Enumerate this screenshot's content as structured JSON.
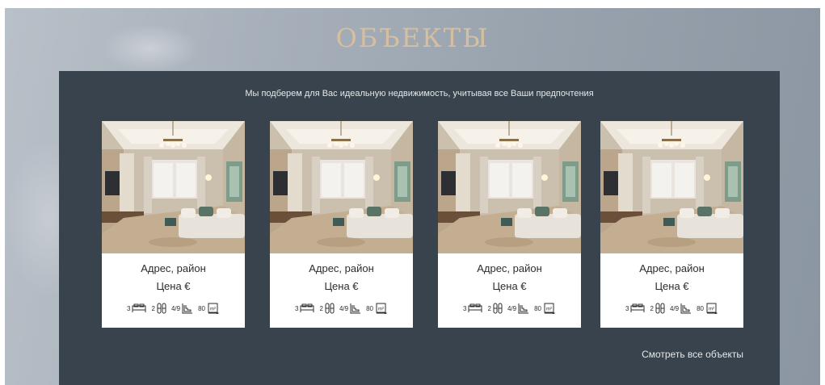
{
  "page": {
    "title": "ОБЪЕКТЫ",
    "subtitle": "Мы подберем для Вас идеальную недвижимость, учитывая все Ваши предпочтения",
    "see_all_label": "Смотреть все объекты"
  },
  "colors": {
    "panel": "#38434d",
    "title": "#d6bf9e",
    "card": "#ffffff"
  },
  "cards": [
    {
      "address": "Адрес, район",
      "price": "Цена €",
      "bedrooms": "3",
      "bathrooms": "2",
      "floor": "4/9",
      "area": "80"
    },
    {
      "address": "Адрес, район",
      "price": "Цена €",
      "bedrooms": "3",
      "bathrooms": "2",
      "floor": "4/9",
      "area": "80"
    },
    {
      "address": "Адрес, район",
      "price": "Цена €",
      "bedrooms": "3",
      "bathrooms": "2",
      "floor": "4/9",
      "area": "80"
    },
    {
      "address": "Адрес, район",
      "price": "Цена €",
      "bedrooms": "3",
      "bathrooms": "2",
      "floor": "4/9",
      "area": "80"
    }
  ],
  "icons": [
    "bed-icon",
    "bathroom-icon",
    "floor-stairs-icon",
    "area-icon"
  ]
}
